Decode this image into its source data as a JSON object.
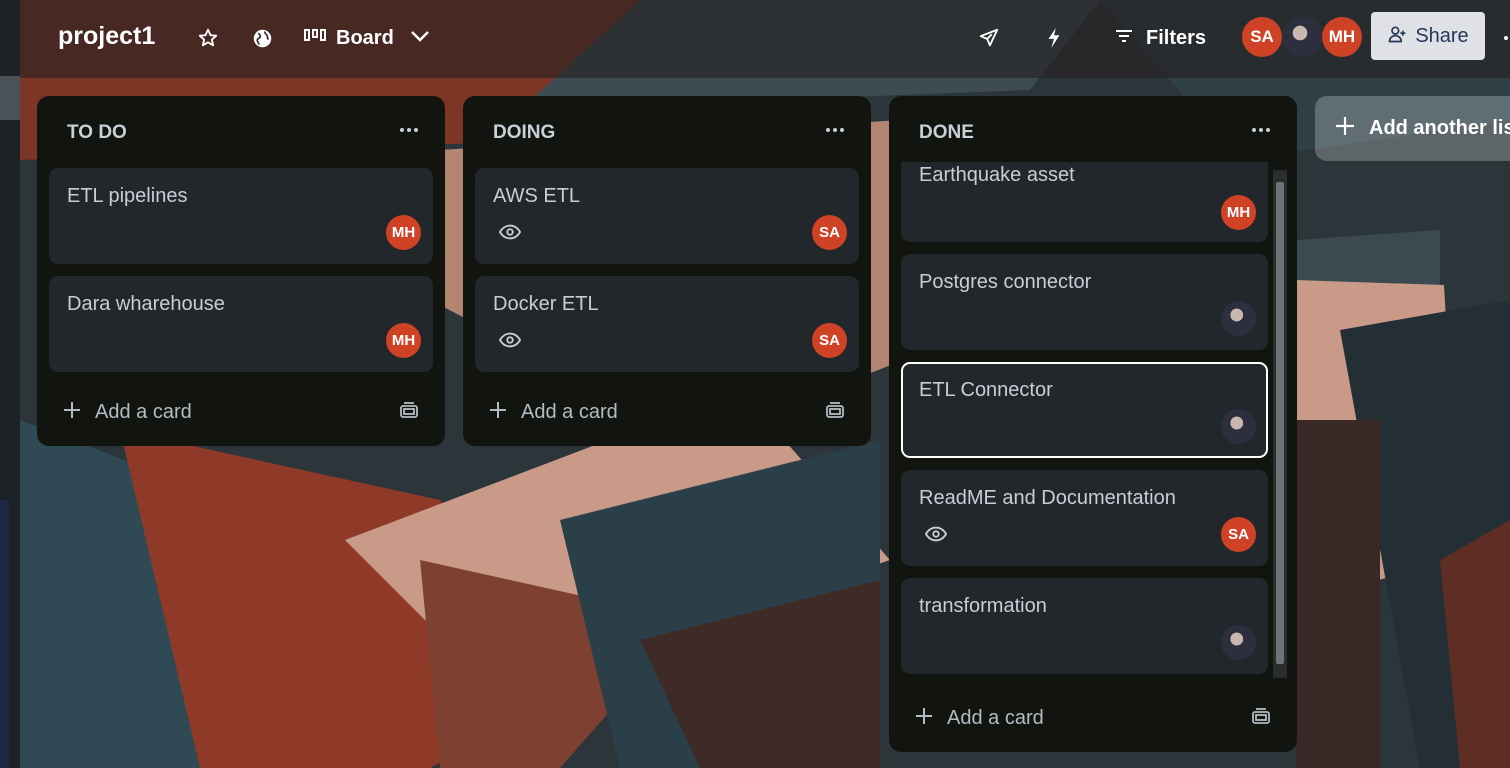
{
  "colors": {
    "header_bg": "#262022",
    "list_bg": "#121410",
    "card_bg": "#22272b",
    "avatar_orange": "#cf4226",
    "share_bg": "#dfe1e6"
  },
  "header": {
    "title": "project1",
    "view_label": "Board",
    "filters_label": "Filters",
    "share_label": "Share",
    "members": [
      {
        "initials": "SA",
        "color": "#cf4226"
      },
      {
        "initials": "",
        "color": "photo"
      },
      {
        "initials": "MH",
        "color": "#cf4226"
      }
    ],
    "icons": [
      "star-icon",
      "globe-icon",
      "board-icon",
      "chevron-down-icon",
      "rocket-icon",
      "lightning-icon",
      "filter-icon",
      "add-user-icon"
    ]
  },
  "lists": [
    {
      "title": "TO DO",
      "cards": [
        {
          "title": "ETL pipelines",
          "member": "MH",
          "watching": false
        },
        {
          "title": "Dara wharehouse",
          "member": "MH",
          "watching": false
        }
      ],
      "add_label": "Add a card"
    },
    {
      "title": "DOING",
      "cards": [
        {
          "title": "AWS ETL",
          "member": "SA",
          "watching": true
        },
        {
          "title": "Docker ETL",
          "member": "SA",
          "watching": true
        }
      ],
      "add_label": "Add a card"
    },
    {
      "title": "DONE",
      "cards": [
        {
          "title": "Earthquake asset",
          "member": "MH",
          "watching": false
        },
        {
          "title": "Postgres connector",
          "member": "photo",
          "watching": false
        },
        {
          "title": "ETL Connector",
          "member": "photo",
          "watching": false
        },
        {
          "title": "ReadME and Documentation",
          "member": "SA",
          "watching": true
        },
        {
          "title": "transformation",
          "member": "photo",
          "watching": false
        }
      ],
      "add_label": "Add a card"
    }
  ],
  "add_list_label": "Add another list"
}
